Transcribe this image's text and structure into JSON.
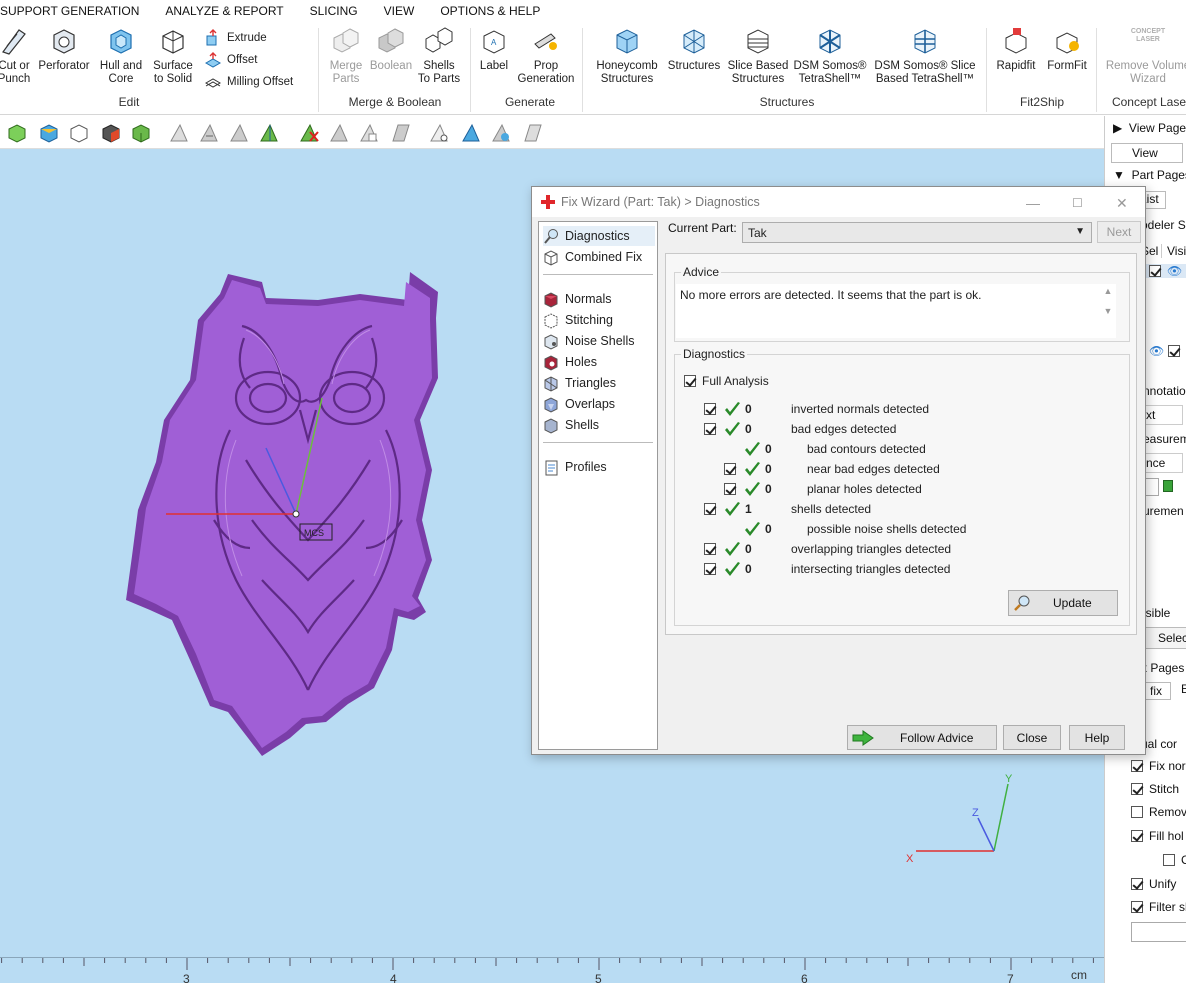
{
  "menu": [
    "SUPPORT GENERATION",
    "ANALYZE & REPORT",
    "SLICING",
    "VIEW",
    "OPTIONS & HELP"
  ],
  "ribbon": {
    "buttons": [
      {
        "id": "cut",
        "label": "Cut or\nPunch"
      },
      {
        "id": "perforator",
        "label": "Perforator"
      },
      {
        "id": "hull",
        "label": "Hull and\nCore"
      },
      {
        "id": "surface",
        "label": "Surface\nto Solid"
      },
      {
        "id": "merge",
        "label": "Merge\nParts"
      },
      {
        "id": "boolean",
        "label": "Boolean"
      },
      {
        "id": "shells",
        "label": "Shells\nTo Parts"
      },
      {
        "id": "label",
        "label": "Label"
      },
      {
        "id": "prop",
        "label": "Prop\nGeneration"
      },
      {
        "id": "honeycomb",
        "label": "Honeycomb\nStructures"
      },
      {
        "id": "structures",
        "label": "Structures"
      },
      {
        "id": "slice",
        "label": "Slice Based\nStructures"
      },
      {
        "id": "dsm",
        "label": "DSM Somos®\nTetraShell™"
      },
      {
        "id": "dsmslice",
        "label": "DSM Somos® Slice\nBased TetraShell™"
      },
      {
        "id": "rapidfit",
        "label": "Rapidfit"
      },
      {
        "id": "formfit",
        "label": "FormFit"
      },
      {
        "id": "removevol",
        "label": "Remove Volume\nWizard"
      }
    ],
    "small": {
      "extrude": "Extrude",
      "offset": "Offset",
      "milling": "Milling Offset"
    },
    "groups": {
      "edit": "Edit",
      "merge": "Merge & Boolean",
      "generate": "Generate",
      "structures": "Structures",
      "fit2ship": "Fit2Ship",
      "laser": "Concept Laser"
    },
    "concept_logo": "CONCEPT\nLASER"
  },
  "ruler": [
    "3",
    "4",
    "5",
    "6",
    "7",
    "cm"
  ],
  "viewport": {
    "axis_x": "X",
    "axis_y": "Y",
    "axis_z": "Z",
    "model_label": "MCS"
  },
  "rpanel": {
    "view_pages": "View Pages",
    "view_btn": "View",
    "part_pages": "Part Pages",
    "list_tab": "List",
    "modeler": "odeler S",
    "sel": "Sel",
    "visi": "Visi",
    "annotation": "nnotatio",
    "text": "xt",
    "measurement": "easurem",
    "distance": "nce",
    "measurements2": "uremen",
    "visible": "isible",
    "select": "Select",
    "fix_pages": "x Pages",
    "fix_tab": "fix",
    "e_tab": "E",
    "manual": "ual cor",
    "checks": [
      {
        "label": "Fix norm",
        "checked": true
      },
      {
        "label": "Stitch",
        "checked": true
      },
      {
        "label": "Remove",
        "checked": false
      },
      {
        "label": "Fill hol",
        "checked": true
      },
      {
        "label": "C",
        "checked": false
      },
      {
        "label": "Unify",
        "checked": true
      },
      {
        "label": "Filter sh",
        "checked": true
      }
    ]
  },
  "dialog": {
    "title": "Fix Wizard (Part: Tak) > Diagnostics",
    "nav": [
      {
        "label": "Diagnostics",
        "icon": "magnifier-icon",
        "selected": true
      },
      {
        "label": "Combined Fix",
        "icon": "combined-fix-icon"
      },
      {
        "label": "Normals",
        "icon": "normals-icon"
      },
      {
        "label": "Stitching",
        "icon": "stitching-icon"
      },
      {
        "label": "Noise Shells",
        "icon": "noise-shells-icon"
      },
      {
        "label": "Holes",
        "icon": "holes-icon"
      },
      {
        "label": "Triangles",
        "icon": "triangles-icon"
      },
      {
        "label": "Overlaps",
        "icon": "overlaps-icon"
      },
      {
        "label": "Shells",
        "icon": "shells-icon"
      },
      {
        "label": "Profiles",
        "icon": "profiles-icon"
      }
    ],
    "current_part_label": "Current Part:",
    "current_part": "Tak",
    "next": "Next",
    "advice_title": "Advice",
    "advice_text": "No more errors are detected. It seems that the part is ok.",
    "diagnostics_title": "Diagnostics",
    "full_analysis": "Full Analysis",
    "rows": [
      {
        "count": "0",
        "text": "inverted normals detected",
        "indent": 0,
        "checkbox": true
      },
      {
        "count": "0",
        "text": "bad edges detected",
        "indent": 0,
        "checkbox": true
      },
      {
        "count": "0",
        "text": "bad contours detected",
        "indent": 1,
        "checkbox": false
      },
      {
        "count": "0",
        "text": "near bad edges detected",
        "indent": 1,
        "checkbox": true
      },
      {
        "count": "0",
        "text": "planar holes detected",
        "indent": 1,
        "checkbox": true
      },
      {
        "count": "1",
        "text": "shells detected",
        "indent": 0,
        "checkbox": true
      },
      {
        "count": "0",
        "text": "possible noise shells detected",
        "indent": 1,
        "checkbox": false
      },
      {
        "count": "0",
        "text": "overlapping triangles detected",
        "indent": 0,
        "checkbox": true
      },
      {
        "count": "0",
        "text": "intersecting triangles detected",
        "indent": 0,
        "checkbox": true
      }
    ],
    "update": "Update",
    "follow_advice": "Follow Advice",
    "close": "Close",
    "help": "Help"
  }
}
